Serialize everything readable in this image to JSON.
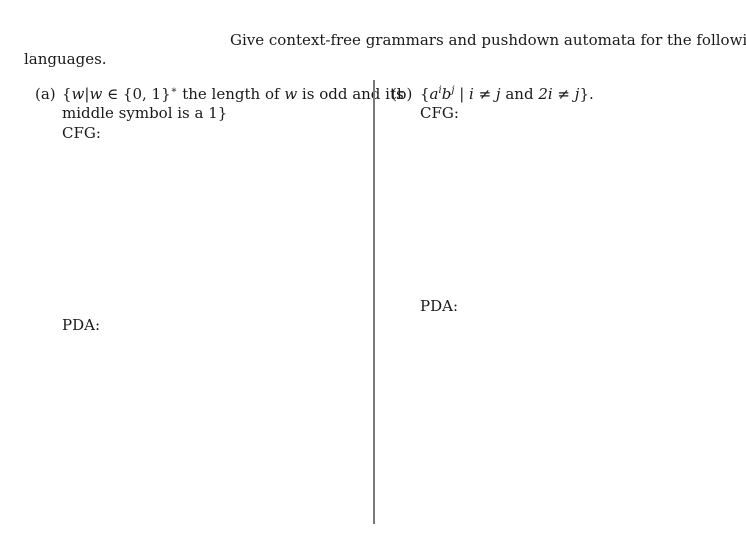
{
  "intro": {
    "line1": "Give context-free grammars and pushdown automata for the following",
    "line2": "languages."
  },
  "part_a": {
    "label": "(a)",
    "set_open": "{",
    "var_w": "w",
    "bar": "|",
    "var_w2": "w",
    "in": " ∈ {0, 1}",
    "star": "∗",
    "text1": " the length of ",
    "var_w3": "w",
    "text2": " is odd and its",
    "line2": "middle symbol is a 1}",
    "cfg_label": "CFG:",
    "pda_label": "PDA:"
  },
  "part_b": {
    "label": "(b)",
    "open": "{",
    "a": "a",
    "i": "i",
    "b": "b",
    "j": "j",
    "cond1": " | i ≠ j",
    "and": " and ",
    "cond2": "2i ≠ j",
    "close": "}.",
    "cfg_label": "CFG:",
    "pda_label": "PDA:"
  }
}
